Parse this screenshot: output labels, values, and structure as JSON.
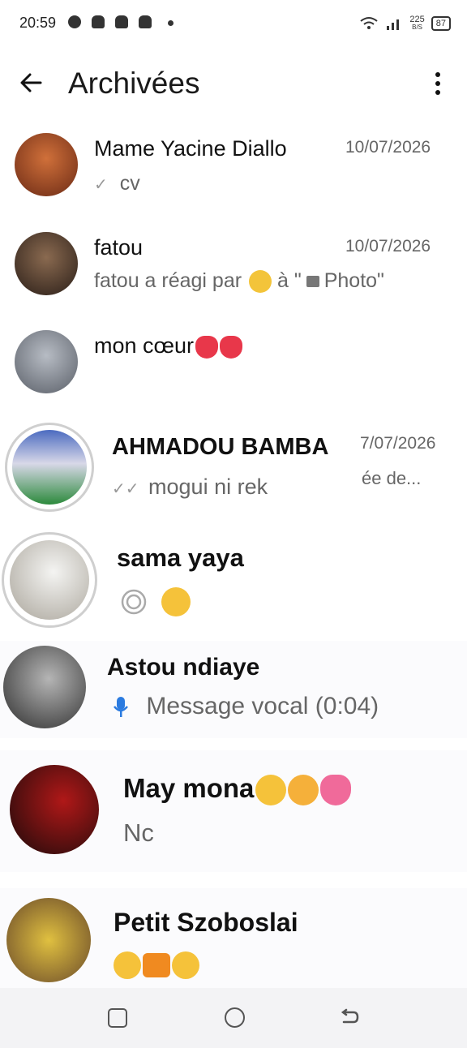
{
  "status_bar": {
    "time": "20:59",
    "speed_top": "225",
    "speed_unit": "B/S",
    "battery": "87",
    "icons": [
      "facebook-icon",
      "snapchat-icon",
      "snapchat-icon",
      "snapchat-icon",
      "dot-icon",
      "wifi-icon",
      "signal-icon"
    ]
  },
  "app_bar": {
    "title": "Archivées",
    "back_icon": "arrow-left-icon",
    "menu_icon": "more-vertical-icon"
  },
  "chats": [
    {
      "name": "Mame Yacine Diallo",
      "date": "10/07/2026",
      "preview": "cv",
      "status_icon": "single-check-icon",
      "avatar_color": "#a0553a"
    },
    {
      "name": "fatou",
      "date": "10/07/2026",
      "preview_text": "fatou a réagi par",
      "preview_a": "à \"",
      "preview_photo": "Photo\"",
      "avatar_color": "#4a3a30"
    },
    {
      "name": "mon cœur",
      "avatar_color": "#8a8f98"
    },
    {
      "name": "AHMADOU BAMBA",
      "date": "7/07/2026",
      "preview": "mogui ni rek",
      "status_icon": "double-check-icon",
      "preview_overflow": "ée de...",
      "avatar_color": "#3d5fa0"
    },
    {
      "name": "sama yaya",
      "status_icon": "status-ring-icon",
      "avatar_color": "#c9c4bc"
    },
    {
      "name": "Astou ndiaye",
      "preview": "Message vocal (0:04)",
      "status_icon": "microphone-icon",
      "avatar_color": "#6b6b6b"
    },
    {
      "name": "May mona",
      "preview": "Nc",
      "avatar_color": "#7a1010"
    },
    {
      "name": "Petit Szoboslai",
      "avatar_color": "#c09040"
    }
  ],
  "nav": {
    "recent_icon": "square-icon",
    "home_icon": "circle-icon",
    "back_icon": "back-arrow-icon"
  }
}
